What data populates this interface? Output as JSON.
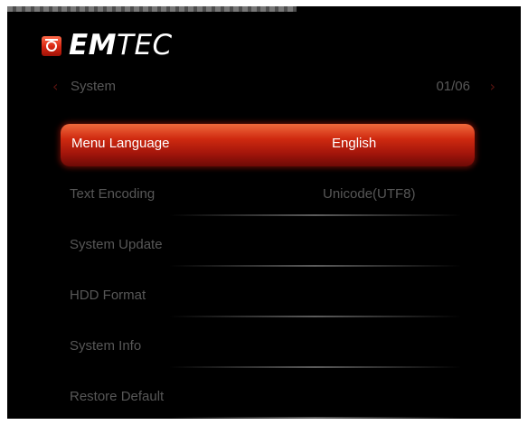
{
  "brand": {
    "logo_text": "EMTEC"
  },
  "header": {
    "title": "System",
    "page_counter": "01/06"
  },
  "menu": {
    "items": [
      {
        "label": "Menu Language",
        "value": "English"
      },
      {
        "label": "Text Encoding",
        "value": "Unicode(UTF8)"
      },
      {
        "label": "System Update",
        "value": ""
      },
      {
        "label": "HDD Format",
        "value": ""
      },
      {
        "label": "System Info",
        "value": ""
      },
      {
        "label": "Restore Default",
        "value": ""
      }
    ],
    "selected_index": 0
  },
  "colors": {
    "accent": "#cf2a10",
    "background": "#000000",
    "text_dim": "#575757"
  }
}
